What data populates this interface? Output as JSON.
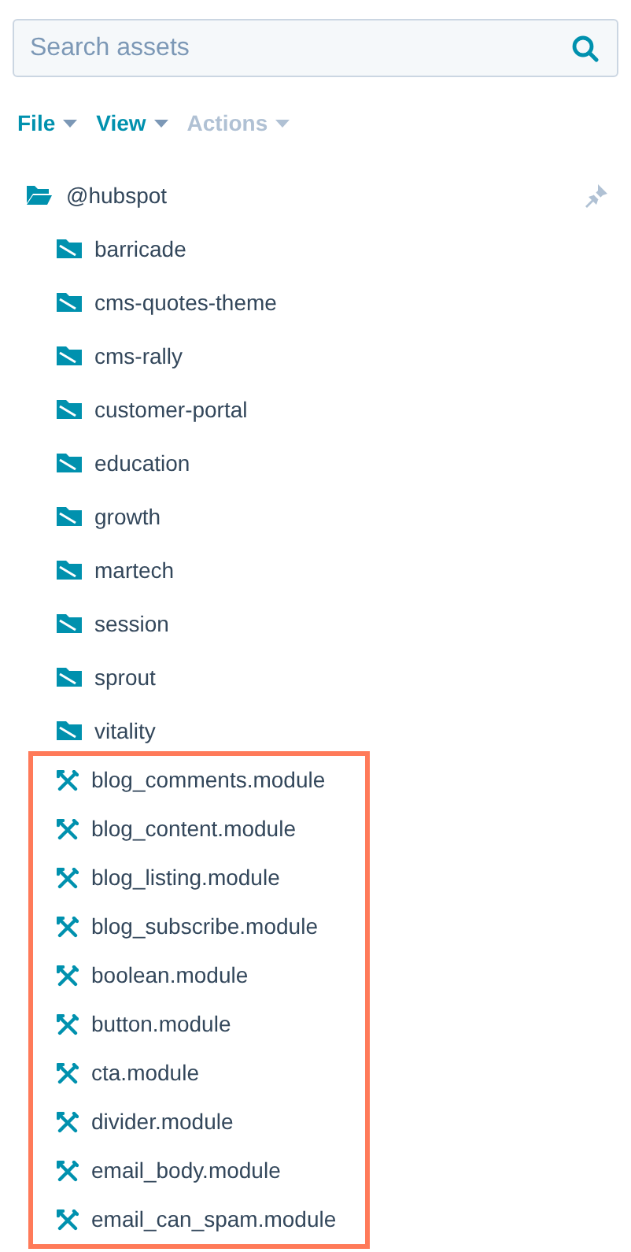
{
  "search": {
    "placeholder": "Search assets"
  },
  "menus": [
    {
      "label": "File",
      "disabled": false
    },
    {
      "label": "View",
      "disabled": false
    },
    {
      "label": "Actions",
      "disabled": true
    }
  ],
  "tree": {
    "label": "@hubspot",
    "expanded": true,
    "children": [
      {
        "label": "barricade",
        "kind": "folder",
        "highlighted": false
      },
      {
        "label": "cms-quotes-theme",
        "kind": "folder",
        "highlighted": false
      },
      {
        "label": "cms-rally",
        "kind": "folder",
        "highlighted": false
      },
      {
        "label": "customer-portal",
        "kind": "folder",
        "highlighted": false
      },
      {
        "label": "education",
        "kind": "folder",
        "highlighted": false
      },
      {
        "label": "growth",
        "kind": "folder",
        "highlighted": false
      },
      {
        "label": "martech",
        "kind": "folder",
        "highlighted": false
      },
      {
        "label": "session",
        "kind": "folder",
        "highlighted": false
      },
      {
        "label": "sprout",
        "kind": "folder",
        "highlighted": false
      },
      {
        "label": "vitality",
        "kind": "folder",
        "highlighted": false
      },
      {
        "label": "blog_comments.module",
        "kind": "module",
        "highlighted": true
      },
      {
        "label": "blog_content.module",
        "kind": "module",
        "highlighted": true
      },
      {
        "label": "blog_listing.module",
        "kind": "module",
        "highlighted": true
      },
      {
        "label": "blog_subscribe.module",
        "kind": "module",
        "highlighted": true
      },
      {
        "label": "boolean.module",
        "kind": "module",
        "highlighted": true
      },
      {
        "label": "button.module",
        "kind": "module",
        "highlighted": true
      },
      {
        "label": "cta.module",
        "kind": "module",
        "highlighted": true
      },
      {
        "label": "divider.module",
        "kind": "module",
        "highlighted": true
      },
      {
        "label": "email_body.module",
        "kind": "module",
        "highlighted": true
      },
      {
        "label": "email_can_spam.module",
        "kind": "module",
        "highlighted": true
      }
    ]
  }
}
